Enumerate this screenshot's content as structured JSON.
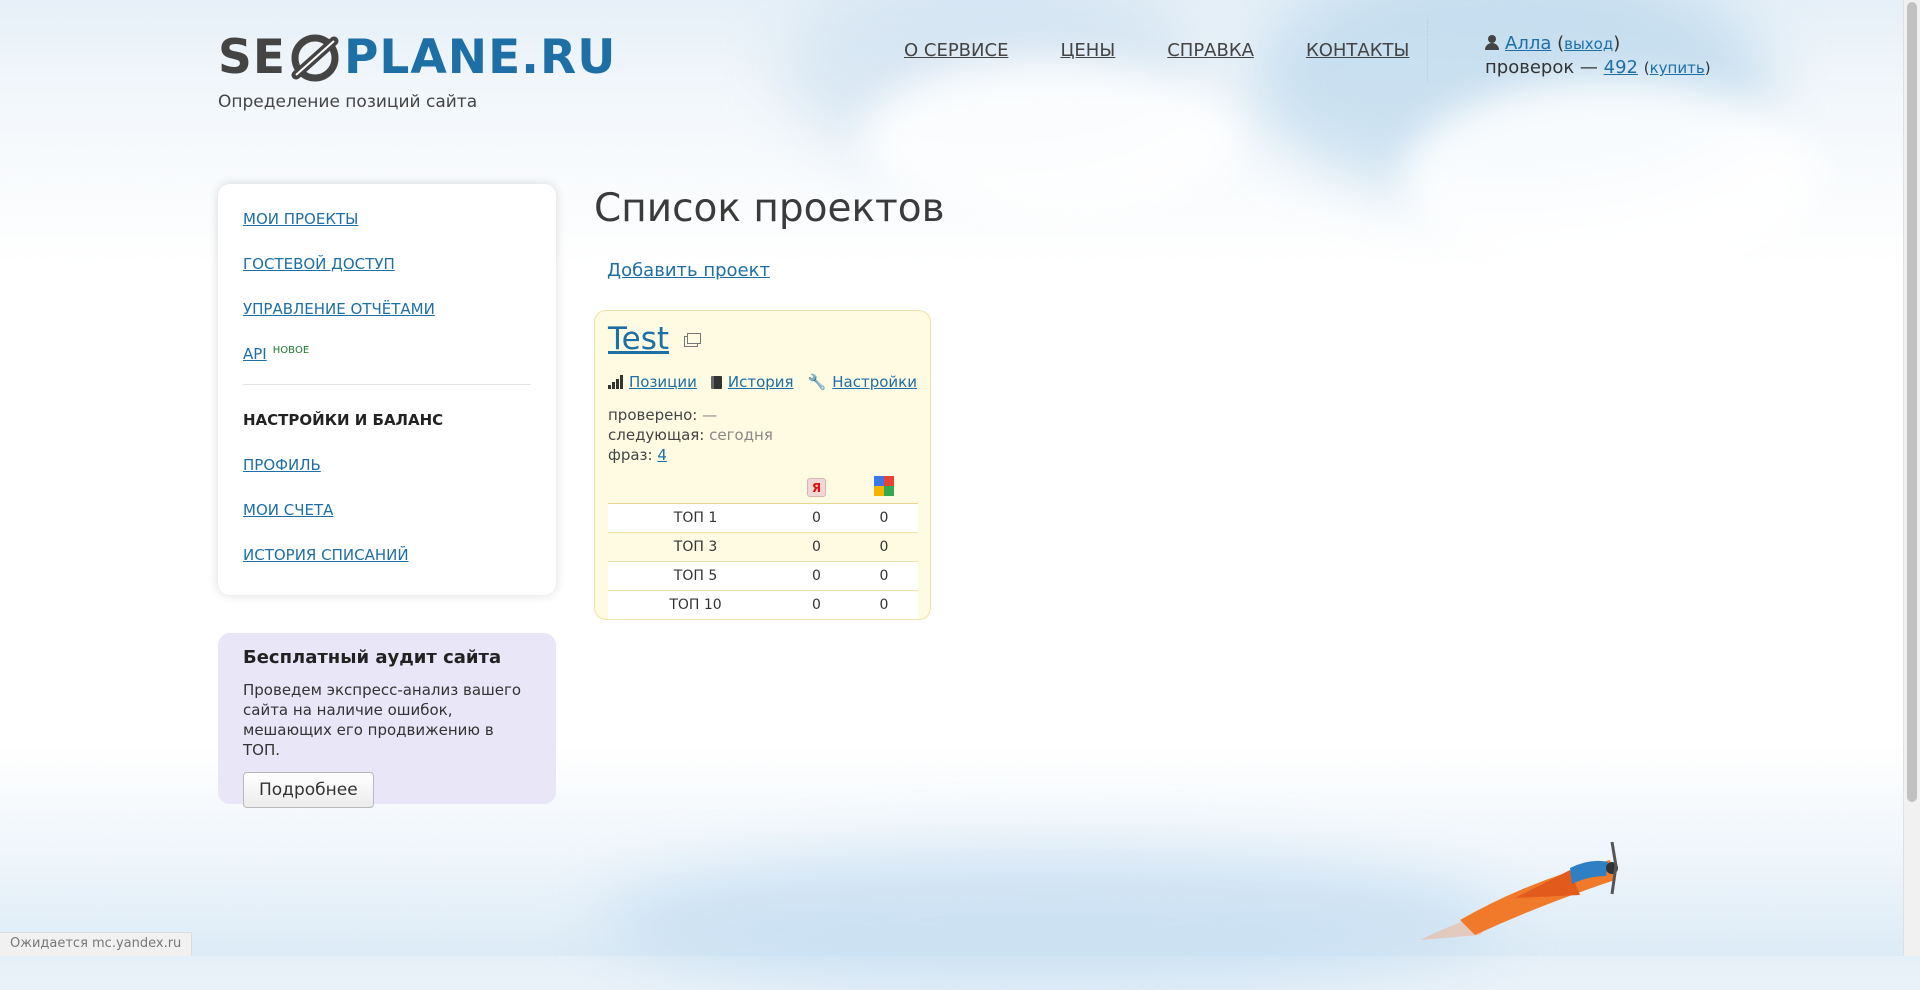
{
  "logo": {
    "left_text": "SE",
    "right_text": "PLANE.RU"
  },
  "tagline": "Определение позиций сайта",
  "nav": [
    {
      "label": "О СЕРВИСЕ"
    },
    {
      "label": "ЦЕНЫ"
    },
    {
      "label": "СПРАВКА"
    },
    {
      "label": "КОНТАКТЫ"
    }
  ],
  "user": {
    "name": "Алла",
    "logout": "выход",
    "checks_label": "проверок —",
    "checks_count": "492",
    "buy": "купить"
  },
  "sidebar": {
    "items": [
      {
        "label": "МОИ ПРОЕКТЫ"
      },
      {
        "label": "ГОСТЕВОЙ ДОСТУП"
      },
      {
        "label": "УПРАВЛЕНИЕ ОТЧЁТАМИ"
      },
      {
        "label": "API",
        "badge": "НОВОЕ"
      }
    ],
    "section_heading": "НАСТРОЙКИ И БАЛАНС",
    "settings_items": [
      {
        "label": "ПРОФИЛЬ"
      },
      {
        "label": "МОИ СЧЕТА"
      },
      {
        "label": "ИСТОРИЯ СПИСАНИЙ"
      }
    ]
  },
  "audit": {
    "title": "Бесплатный аудит сайта",
    "text": "Проведем экспресс-анализ вашего сайта на наличие ошибок, мешающих его продвижению в ТОП.",
    "button": "Подробнее"
  },
  "main": {
    "title": "Список проектов",
    "add_project": "Добавить проект",
    "project": {
      "name": "Test",
      "links": {
        "positions": "Позиции",
        "history": "История",
        "settings": "Настройки"
      },
      "checked_label": "проверено:",
      "checked_value": "—",
      "next_label": "следующая:",
      "next_value": "сегодня",
      "phrases_label": "фраз:",
      "phrases_value": "4",
      "search_engines": [
        "yandex-icon",
        "google-icon"
      ],
      "tops": [
        {
          "label": "ТОП 1",
          "yandex": "0",
          "google": "0"
        },
        {
          "label": "ТОП 3",
          "yandex": "0",
          "google": "0"
        },
        {
          "label": "ТОП 5",
          "yandex": "0",
          "google": "0"
        },
        {
          "label": "ТОП 10",
          "yandex": "0",
          "google": "0"
        }
      ]
    }
  },
  "status_bar": "Ожидается mc.yandex.ru",
  "colors": {
    "link": "#1d6fa5",
    "logo_blue": "#1e6fa5",
    "card_bg": "#fffbe3",
    "audit_bg": "#e8e6f7"
  }
}
